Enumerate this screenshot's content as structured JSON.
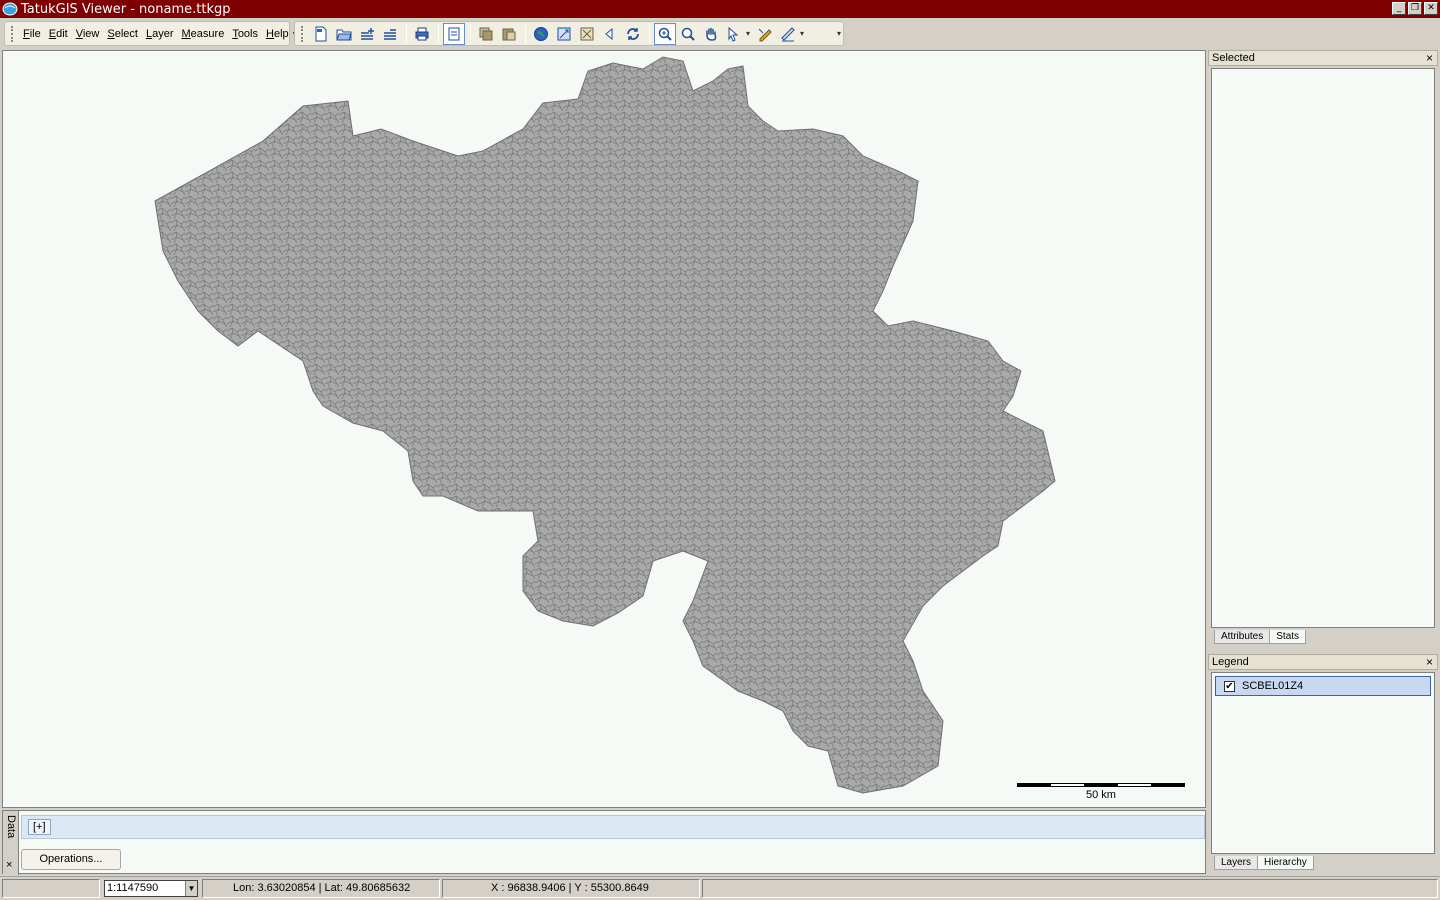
{
  "window": {
    "title": "TatukGIS Viewer - noname.ttkgp",
    "minimize": "_",
    "restore": "❐",
    "close": "✕"
  },
  "menu": {
    "items": [
      {
        "accel": "F",
        "rest": "ile"
      },
      {
        "accel": "E",
        "rest": "dit"
      },
      {
        "accel": "V",
        "rest": "iew"
      },
      {
        "accel": "S",
        "rest": "elect"
      },
      {
        "accel": "L",
        "rest": "ayer"
      },
      {
        "accel": "M",
        "rest": "easure"
      },
      {
        "accel": "T",
        "rest": "ools"
      },
      {
        "accel": "H",
        "rest": "elp"
      }
    ]
  },
  "toolbar": {
    "buttons": [
      "new-icon",
      "open-icon",
      "add-layer-icon",
      "remove-layer-icon",
      "print-icon",
      "export-icon",
      "copy-icon",
      "paste-icon",
      "globe-icon",
      "zoom-extent-icon",
      "zoom-layer-icon",
      "back-icon",
      "refresh-icon",
      "zoom-icon",
      "zoom-out-icon",
      "pan-icon",
      "select-icon",
      "edit-icon",
      "measure-icon"
    ]
  },
  "map": {
    "background": "#f5faf7",
    "region_fill": "#a9a9a9",
    "region_stroke": "#6e6e6e",
    "scalebar_label": "50 km"
  },
  "data_panel": {
    "tab_label": "Data",
    "close": "×",
    "expand_label": "[+]",
    "operations_label": "Operations..."
  },
  "selected_panel": {
    "title": "Selected",
    "close": "×",
    "tabs": [
      "Attributes",
      "Stats"
    ]
  },
  "legend_panel": {
    "title": "Legend",
    "close": "×",
    "layer_name": "SCBEL01Z4",
    "layer_checked": "✔",
    "tabs": [
      "Layers",
      "Hierarchy"
    ]
  },
  "status": {
    "scale": "1:1147590",
    "lonlat": "Lon: 3.63020854 | Lat: 49.80685632",
    "xy": "X : 96838.9406 | Y : 55300.8649"
  }
}
